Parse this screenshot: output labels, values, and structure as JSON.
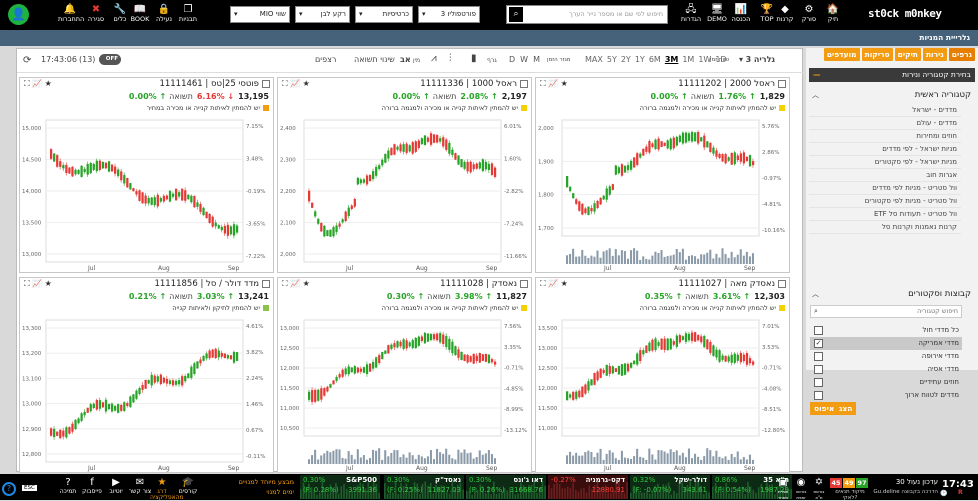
{
  "topbar": {
    "logo": "st0ck m0nkey",
    "right_items": [
      {
        "label": "תיק",
        "icon": "briefcase-icon",
        "glyph": "🏠"
      },
      {
        "label": "סורק",
        "icon": "scanner-icon",
        "glyph": "⚙"
      },
      {
        "label": "קרנות",
        "icon": "diamond-icon",
        "glyph": "◆"
      },
      {
        "label": "TOP",
        "icon": "trophy-icon",
        "glyph": "🏆"
      },
      {
        "label": "הכנסה",
        "icon": "chart-icon",
        "glyph": "📊"
      },
      {
        "label": "DEMO",
        "icon": "demo-icon",
        "glyph": "🖥"
      },
      {
        "label": "הגדרות",
        "icon": "settings-icon",
        "glyph": "🖧"
      }
    ],
    "search_placeholder": "חיפוש לפי שם או מספר נייר הערך",
    "portfolio_select": "פורטפוליו 3",
    "select2": "כרטיסיות",
    "select3": "רקע לבן",
    "select4": "שווי MIO",
    "left_items": [
      {
        "label": "תבניות",
        "icon": "templates-icon",
        "glyph": "❐"
      },
      {
        "label": "נעילה",
        "icon": "lock-icon",
        "glyph": "🔒"
      },
      {
        "label": "BOOK",
        "icon": "book-icon",
        "glyph": "📖"
      },
      {
        "label": "כלים",
        "icon": "tools-icon",
        "glyph": "🔧"
      },
      {
        "label": "סגירה",
        "icon": "close-icon",
        "glyph": "✖"
      },
      {
        "label": "התחברות",
        "icon": "bell-icon",
        "glyph": "🔔"
      }
    ]
  },
  "title": "גלרייית המניות",
  "chart_toolbar": {
    "time": "17:43:06",
    "count": "(13)",
    "off_label": "OFF",
    "candles": "רצפים",
    "label_chg": "שינוי תשואה",
    "label_av": "אב",
    "label_nin": "מין",
    "label_graph": "גרף",
    "periods": [
      "D",
      "W",
      "M"
    ],
    "period_label": "מגזר הזמן",
    "ranges": [
      "MAX",
      "5Y",
      "2Y",
      "1Y",
      "6M",
      "3M",
      "1M",
      "1W",
      "1D"
    ],
    "active_range": "3M",
    "range_label": "טווח זמן",
    "gallery": "גלריה 3"
  },
  "panels": [
    {
      "name": "ראסל 2000",
      "id": "11111202",
      "price": "1,829",
      "arrow": "↑",
      "pct": "1.76%",
      "ret": "0.00%",
      "ret_lbl": "תשואה",
      "dir": "up",
      "note": "יש להמתין לאיתות קנייה או מכירה ולמגמה ברורה",
      "note_color": "#f2d200",
      "yticks": [
        "2,000",
        "1,900",
        "1,800",
        "1,700"
      ],
      "rticks": [
        "5.76%",
        "2.86%",
        "-0.97%",
        "-4.81%",
        "-10.16%"
      ],
      "xticks": [
        "Jul",
        "Aug",
        "Sep"
      ],
      "volume": true
    },
    {
      "name": "ראסל 1000",
      "id": "11111336",
      "price": "2,197",
      "arrow": "↑",
      "pct": "2.08%",
      "ret": "0.00%",
      "ret_lbl": "תשואה",
      "dir": "up",
      "note": "יש להמתין לאיתות קנייה או מכירה ולמגמה ברורה",
      "note_color": "#f2d200",
      "yticks": [
        "2,400",
        "2,300",
        "2,200",
        "2,100",
        "2,000"
      ],
      "rticks": [
        "6.01%",
        "1.60%",
        "-2.82%",
        "-7.24%",
        "-11.66%"
      ],
      "xticks": [
        "Jul",
        "Aug",
        "Sep"
      ],
      "volume": false
    },
    {
      "name": "פוטסי 25|טס",
      "id": "11111461",
      "price": "13,195",
      "arrow": "↓",
      "pct": "6.16%",
      "ret": "0.00%",
      "ret_lbl": "תשואה",
      "dir": "dn",
      "note": "יש להמתין לאיתות קנייה או מכירה במחיר",
      "note_color": "#f39c12",
      "yticks": [
        "15,000",
        "14,500",
        "14,000",
        "13,500",
        "13,000"
      ],
      "rticks": [
        "7.15%",
        "3.48%",
        "-0.19%",
        "-3.65%",
        "-7.22%"
      ],
      "xticks": [
        "Jul",
        "Aug",
        "Sep"
      ],
      "volume": false
    },
    {
      "name": "נאסדק מאה",
      "id": "11111027",
      "price": "12,303",
      "arrow": "↑",
      "pct": "3.61%",
      "ret": "0.35%",
      "ret_lbl": "תשואה",
      "dir": "up",
      "note": "יש להמתין לאיתות קנייה או מכירה ולמגמה ברורה",
      "note_color": "#f2d200",
      "yticks": [
        "13,500",
        "13,000",
        "12,500",
        "12,000",
        "11,500",
        "11,000"
      ],
      "rticks": [
        "7.01%",
        "3.53%",
        "-0.71%",
        "-4.08%",
        "-8.51%",
        "-12.80%"
      ],
      "xticks": [
        "Jul",
        "Aug",
        "Sep"
      ],
      "volume": true
    },
    {
      "name": "נאסדק",
      "id": "11111028",
      "price": "11,827",
      "arrow": "↑",
      "pct": "3.98%",
      "ret": "0.30%",
      "ret_lbl": "תשואה",
      "dir": "up",
      "note": "יש להמתין לאיתות קנייה או מכירה ולמגמה ברורה",
      "note_color": "#f2d200",
      "yticks": [
        "13,000",
        "12,500",
        "12,000",
        "11,500",
        "11,000",
        "10,500"
      ],
      "rticks": [
        "7.56%",
        "3.35%",
        "-0.71%",
        "-4.85%",
        "-8.99%",
        "-13.12%"
      ],
      "xticks": [
        "Jul",
        "Aug",
        "Sep"
      ],
      "volume": true
    },
    {
      "name": "מדד דולר / סל",
      "id": "11111856",
      "price": "13,241",
      "arrow": "↑",
      "pct": "3.03%",
      "ret": "0.21%",
      "ret_lbl": "תשואה",
      "dir": "up",
      "note": "יש להמתין לתיקון ולאיתות קנייה",
      "note_color": "#8bc34a",
      "yticks": [
        "13,300",
        "13,200",
        "13,100",
        "13,000",
        "12,900",
        "12,800"
      ],
      "rticks": [
        "4.61%",
        "3.82%",
        "2.24%",
        "1.46%",
        "0.67%",
        "-0.11%"
      ],
      "xticks": [
        "Jul",
        "Aug",
        "Sep"
      ],
      "volume": false
    }
  ],
  "right_panel": {
    "tabs": [
      "גרפים",
      "נירות",
      "תיקים",
      "סריקות",
      "מועדפים"
    ],
    "active_tab": "גרפים",
    "section_title": "בחירת קטגוריה ונירות",
    "main_cat_title": "קטגוריה ראשית",
    "main_cats": [
      "מדדים - ישראל",
      "מדדים - עולם",
      "חוזים ומחירות",
      "מניות ישראל - לפי מדדים",
      "מניות ישראל - לפי סקטורים",
      "אגרות חוב",
      "וול סטריט - מניות לפי מדדים",
      "וול סטריט - מניות לפי סקטורים",
      "וול סטריט - תעודות סל ETF",
      "קרנות נאמנות וקרנות סל"
    ],
    "sub_title": "קבוצות וסקטורים",
    "search_placeholder": "חיפוש קטגוריה",
    "checks": [
      {
        "label": "כל מדדי חול",
        "checked": false
      },
      {
        "label": "מדדי אמריקה",
        "checked": true
      },
      {
        "label": "מדדי אירופה",
        "checked": false
      },
      {
        "label": "מדדי אסיה",
        "checked": false
      },
      {
        "label": "חוזים עתידיים",
        "checked": false
      },
      {
        "label": "מדדים לטווח ארוך",
        "checked": false
      }
    ],
    "btn_show": "הצג",
    "btn_reset": "איפוס"
  },
  "bottombar": {
    "left_items": [
      {
        "label": "תמיכה",
        "icon": "help-icon",
        "glyph": "?"
      },
      {
        "label": "פייסבוק",
        "icon": "facebook-icon",
        "glyph": "f"
      },
      {
        "label": "יוטיוב",
        "icon": "youtube-icon",
        "glyph": "▶"
      },
      {
        "label": "צור קשר",
        "icon": "mail-icon",
        "glyph": "✉"
      },
      {
        "label": "דרג מהאפליקציה",
        "icon": "rate-icon",
        "glyph": "★"
      },
      {
        "label": "קורסים",
        "icon": "courses-icon",
        "glyph": "🎓"
      }
    ],
    "promo_line1": "ימים למנוי",
    "promo_line2": "מבצע מיוחד למנויים",
    "esc": "ESC",
    "tickers": [
      {
        "name": "S&P500",
        "v": "3991.36",
        "p1": "0.30%",
        "p2": "(F: 0.28%)",
        "dir": "up"
      },
      {
        "name": "נאסד\"ק",
        "v": "11827.03",
        "p1": "0.30%",
        "p2": "(F: 0.25%)",
        "dir": "up"
      },
      {
        "name": "דאו ג'ונס",
        "v": "31668.76",
        "p1": "0.30%",
        "p2": "(F: 0.26%)",
        "dir": "up"
      },
      {
        "name": "דקס-גרמניה",
        "v": "12880.91",
        "p1": "-0.27%",
        "p2": "",
        "dir": "dn"
      },
      {
        "name": "דולר-שקל",
        "v": "343.61",
        "p1": "0.32%",
        "p2": "(F: -0.07%)",
        "dir": "up"
      },
      {
        "name": "ת\"א 35",
        "v": "1987.29",
        "p1": "0.86%",
        "p2": "(F: 0.54%)",
        "dir": "up"
      }
    ],
    "flags": [
      {
        "label": "סגירת מסחר",
        "icon": "us-flag-icon",
        "glyph": "▣"
      },
      {
        "label": "בורסה זמנית",
        "icon": "world-icon",
        "glyph": "◉"
      },
      {
        "label": "בורסת ת\"א",
        "icon": "il-flag-icon",
        "glyph": "✡"
      }
    ],
    "scores": [
      "45",
      "49",
      "97"
    ],
    "score_label": "מיקוד תנאים לאקי?",
    "update_label": "עדכון נעול 30",
    "update_sub": "Gu.deline הדרכה בקבוצה",
    "clock": "17:43",
    "brand": "R"
  }
}
